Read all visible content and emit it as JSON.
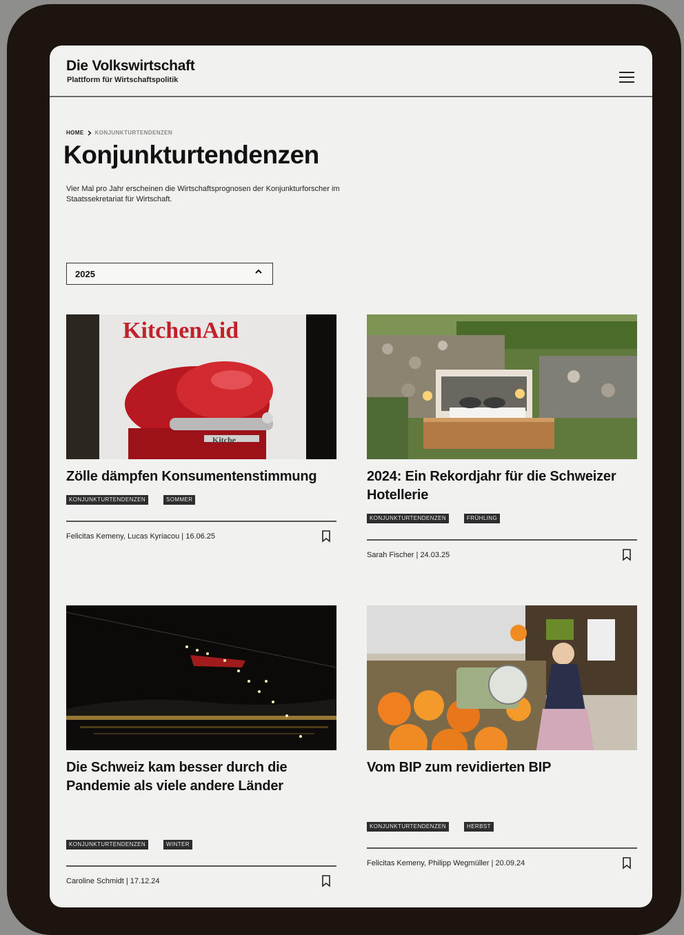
{
  "header": {
    "title": "Die Volkswirtschaft",
    "subtitle": "Plattform für Wirtschaftspolitik",
    "menu_icon": "hamburger-menu-icon"
  },
  "breadcrumb": {
    "home": "HOME",
    "current": "KONJUNKTURTENDENZEN"
  },
  "page": {
    "title": "Konjunkturtendenzen",
    "intro": "Vier Mal pro Jahr erscheinen die Wirtschaftsprognosen der Konjunkturforscher im Staatssekretariat für Wirtschaft."
  },
  "year_select": {
    "value": "2025"
  },
  "articles": [
    {
      "title": "Zölle dämpfen Konsumentenstimmung",
      "tags": [
        "KONJUNKTURTENDENZEN",
        "SOMMER"
      ],
      "meta": "Felicitas Kemeny, Lucas Kyriacou | 16.06.25",
      "image_text": "KitchenAid",
      "image_text_small": "Kitche"
    },
    {
      "title": "2024: Ein Rekordjahr für die Schweizer Hotellerie",
      "tags": [
        "KONJUNKTURTENDENZEN",
        "FRÜHLING"
      ],
      "meta": "Sarah Fischer | 24.03.25"
    },
    {
      "title": "Die Schweiz kam besser durch die Pandemie als viele andere Länder",
      "tags": [
        "KONJUNKTURTENDENZEN",
        "WINTER"
      ],
      "meta": "Caroline Schmidt | 17.12.24"
    },
    {
      "title": "Vom BIP zum revidierten BIP",
      "tags": [
        "KONJUNKTURTENDENZEN",
        "HERBST"
      ],
      "meta": "Felicitas Kemeny, Philipp Wegmüller | 20.09.24"
    }
  ],
  "colors": {
    "page_bg": "#f1f1ef",
    "device_frame": "#1c140f",
    "tag_bg": "#2d2d2d",
    "kitchenaid_red": "#c0212b"
  }
}
